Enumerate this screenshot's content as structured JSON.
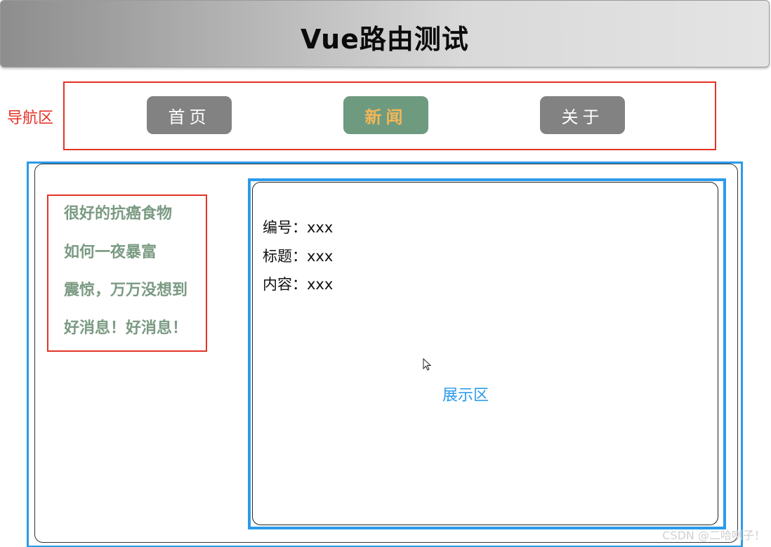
{
  "header": {
    "title": "Vue路由测试"
  },
  "nav": {
    "area_label": "导航区",
    "buttons": [
      {
        "label": "首页",
        "active": false
      },
      {
        "label": "新闻",
        "active": true
      },
      {
        "label": "关于",
        "active": false
      }
    ]
  },
  "news_list": [
    "很好的抗癌食物",
    "如何一夜暴富",
    "震惊，万万没想到",
    "好消息！好消息！"
  ],
  "detail": {
    "rows": [
      "编号：xxx",
      "标题：xxx",
      "内容：xxx"
    ],
    "area_label": "展示区"
  },
  "watermark": "CSDN @二哈喇子！",
  "colors": {
    "nav_border": "#e33326",
    "display_border": "#2b9bea",
    "active_button_bg": "#6e9a80",
    "active_button_text": "#f2b757",
    "button_bg": "#828282",
    "list_text": "#7a9a82"
  }
}
